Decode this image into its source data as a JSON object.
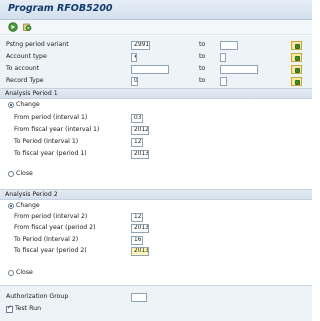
{
  "title": "Program RFOB5200",
  "toolbar": {
    "icons": [
      "execute-icon",
      "variant-icon"
    ]
  },
  "params": [
    {
      "label": "Pstng period variant",
      "value": "Z991",
      "to_label": "to",
      "to_value": ""
    },
    {
      "label": "Account type",
      "value": "#",
      "to_label": "to",
      "to_value": ""
    },
    {
      "label": "To account",
      "value": "",
      "to_label": "to",
      "to_value": ""
    },
    {
      "label": "Record Type",
      "value": "0",
      "to_label": "to",
      "to_value": ""
    }
  ],
  "period1": {
    "header": "Analysis Period 1",
    "change_label": "Change",
    "close_label": "Close",
    "fields": [
      {
        "label": "From period (interval 1)",
        "value": "03"
      },
      {
        "label": "From fiscal year (interval 1)",
        "value": "2012"
      },
      {
        "label": "To Period (Interval 1)",
        "value": "12"
      },
      {
        "label": "To fiscal year (period 1)",
        "value": "2013"
      }
    ]
  },
  "period2": {
    "header": "Analysis Period 2",
    "change_label": "Change",
    "close_label": "Close",
    "fields": [
      {
        "label": "From period (interval 2)",
        "value": "12"
      },
      {
        "label": "From fiscal year (period 2)",
        "value": "2013"
      },
      {
        "label": "To Period (Interval 2)",
        "value": "16"
      },
      {
        "label": "To fiscal year (period 2)",
        "value": "2013"
      }
    ]
  },
  "auth_group": {
    "label": "Authorization Group",
    "value": ""
  },
  "test_run": {
    "label": "Test Run",
    "checked": true
  },
  "colors": {
    "title": "#123a6c",
    "background": "#eef3f8",
    "header": "#d6e1ec"
  }
}
